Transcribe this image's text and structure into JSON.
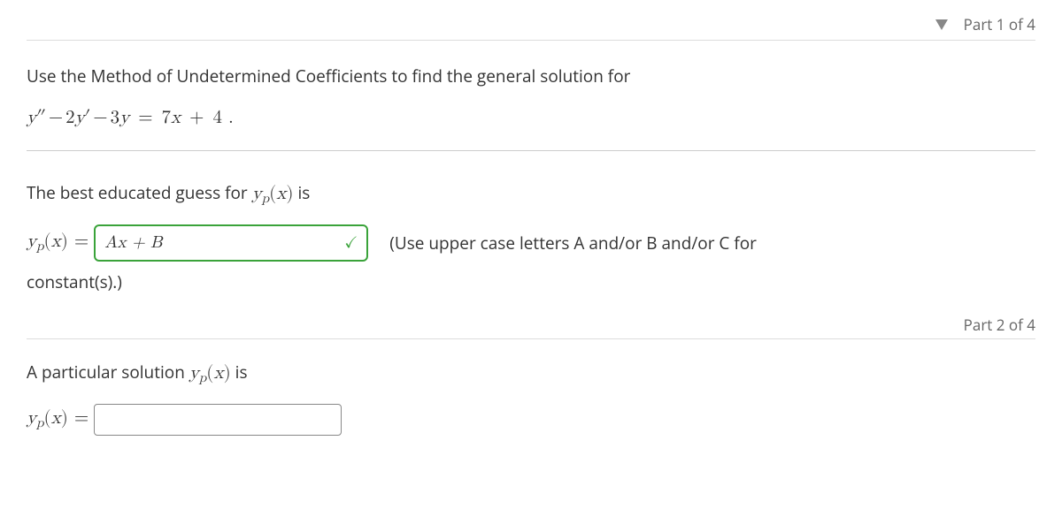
{
  "part1": {
    "label": "Part 1 of 4"
  },
  "problem": {
    "intro": "Use the Method of Undetermined Coefficients to find the general solution for",
    "equation_display": "y″−2y′−3y = 7x + 4 ."
  },
  "guess": {
    "prompt_pre": "The best educated guess for ",
    "prompt_post": " is",
    "yp_label": "y",
    "yp_sub": "p",
    "yp_arg": "(x)",
    "equals": " = ",
    "input_value": "Ax + B",
    "hint": "(Use upper case letters A and/or B and/or C for",
    "hint_line2": "constant(s).)"
  },
  "part2": {
    "label": "Part 2 of 4"
  },
  "particular": {
    "prompt_pre": "A particular solution ",
    "prompt_post": " is",
    "input_value": ""
  }
}
